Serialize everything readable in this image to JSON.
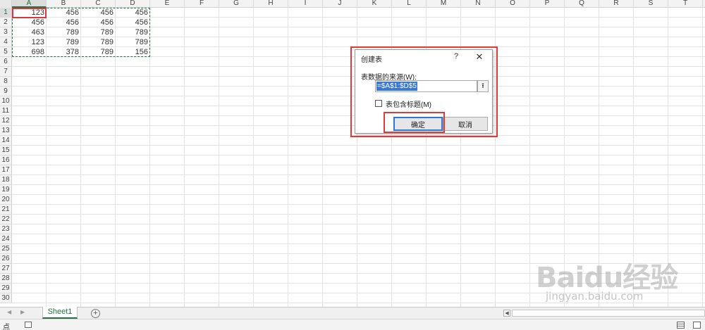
{
  "sheet": {
    "columns": [
      "A",
      "B",
      "C",
      "D",
      "E",
      "F",
      "G",
      "H",
      "I",
      "J",
      "K",
      "L",
      "M",
      "N",
      "O",
      "P",
      "Q",
      "R",
      "S",
      "T"
    ],
    "rows": [
      1,
      2,
      3,
      4,
      5,
      6,
      7,
      8,
      9,
      10,
      11,
      12,
      13,
      14,
      15,
      16,
      17,
      18,
      19,
      20,
      21,
      22,
      23,
      24,
      25,
      26,
      27,
      28,
      29,
      30
    ],
    "selected_column": "A",
    "selected_row": 1,
    "data": [
      [
        "123",
        "456",
        "456",
        "456"
      ],
      [
        "456",
        "456",
        "456",
        "456"
      ],
      [
        "463",
        "789",
        "789",
        "789"
      ],
      [
        "123",
        "789",
        "789",
        "789"
      ],
      [
        "698",
        "378",
        "789",
        "156"
      ]
    ]
  },
  "dialog": {
    "title": "创建表",
    "help": "?",
    "close": "✕",
    "source_label": "表数据的来源(W):",
    "range_value": "=$A$1:$D$5",
    "collapse_icon": "⭱",
    "has_headers_label": "表包含标题(M)",
    "has_headers_checked": false,
    "ok_label": "确定",
    "cancel_label": "取消"
  },
  "tabs": {
    "sheet_name": "Sheet1",
    "add_label": "+",
    "nav_prev": "◀",
    "nav_next": "▶"
  },
  "status": {
    "text": "点"
  },
  "watermark": {
    "main": "Baidu经验",
    "sub": "jingyan.baidu.com"
  },
  "colors": {
    "accent": "#217346",
    "highlight": "#e03a3a",
    "selection": "#3a78d6"
  }
}
